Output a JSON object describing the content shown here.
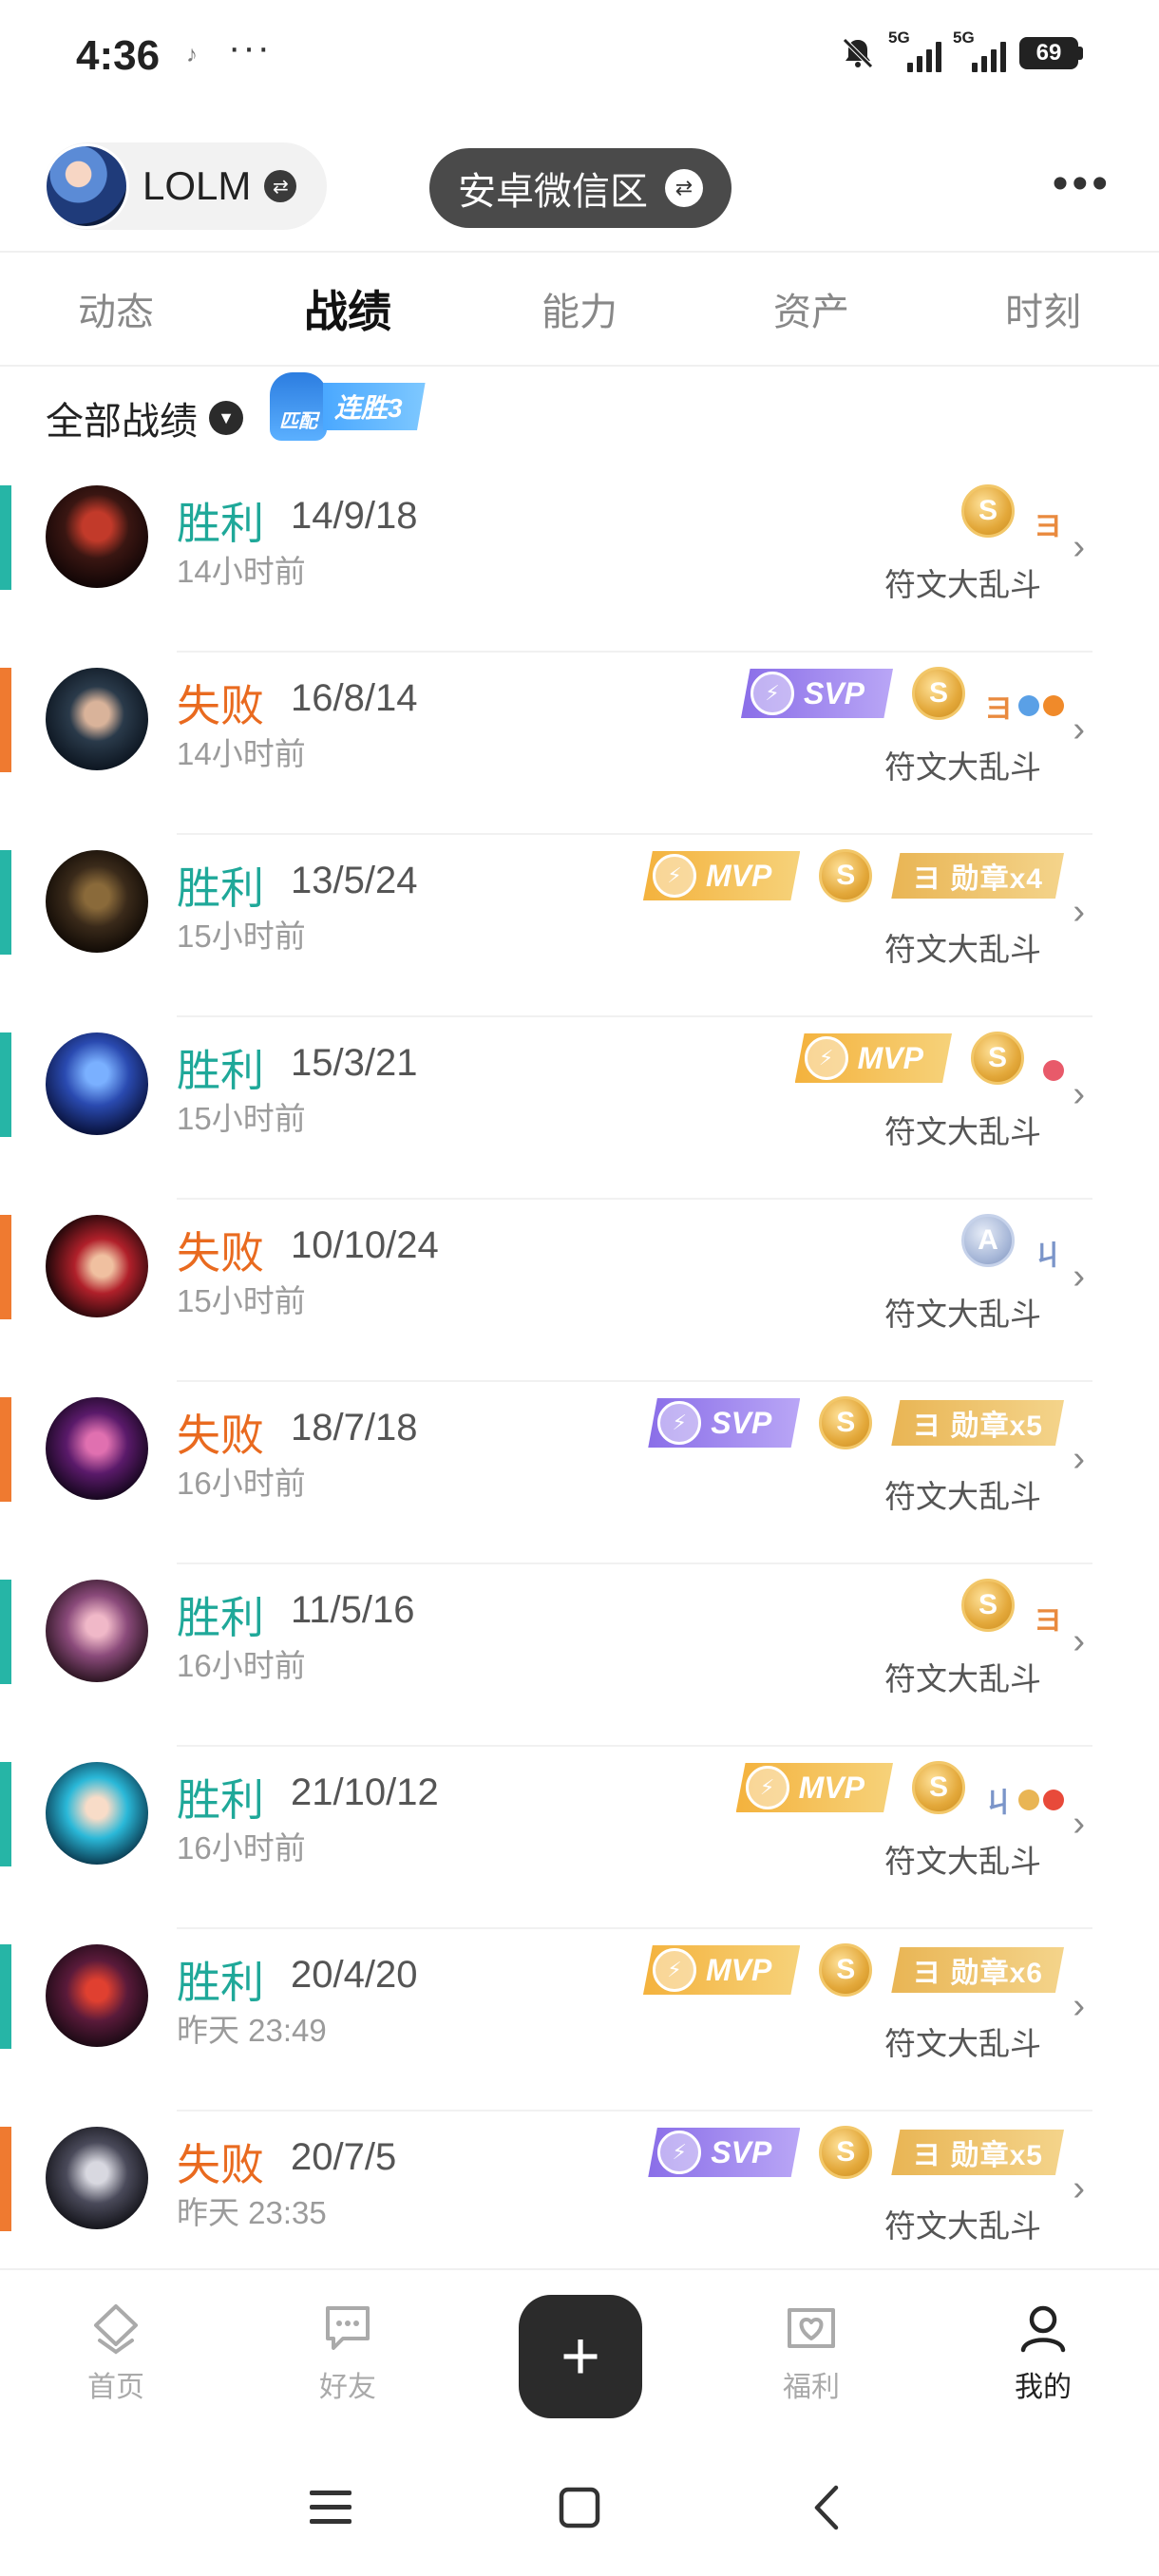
{
  "status_bar": {
    "time": "4:36",
    "dots": "···",
    "net1": "5G",
    "net2": "5G",
    "battery": "69"
  },
  "header": {
    "game_name": "LOLM",
    "region": "安卓微信区"
  },
  "tabs": [
    {
      "label": "动态",
      "active": false
    },
    {
      "label": "战绩",
      "active": true
    },
    {
      "label": "能力",
      "active": false
    },
    {
      "label": "资产",
      "active": false
    },
    {
      "label": "时刻",
      "active": false
    }
  ],
  "filter": {
    "label": "全部战绩",
    "streak_mode": "匹配",
    "streak_text": "连胜3"
  },
  "colors": {
    "win": "#26b5a6",
    "loss": "#ef7a30",
    "mvp": "#f4b23d",
    "svp": "#8a6ee8"
  },
  "matches": [
    {
      "result": "胜利",
      "outcome": "win",
      "kda": "14/9/18",
      "time": "14小时前",
      "mode": "符文大乱斗",
      "badges": [
        "S"
      ],
      "achv": "ヨ"
    },
    {
      "result": "失败",
      "outcome": "loss",
      "kda": "16/8/14",
      "time": "14小时前",
      "mode": "符文大乱斗",
      "badges": [
        "SVP",
        "S"
      ],
      "achv": "ヨ"
    },
    {
      "result": "胜利",
      "outcome": "win",
      "kda": "13/5/24",
      "time": "15小时前",
      "mode": "符文大乱斗",
      "badges": [
        "MVP",
        "S"
      ],
      "medal": "ヨ 勋章x4"
    },
    {
      "result": "胜利",
      "outcome": "win",
      "kda": "15/3/21",
      "time": "15小时前",
      "mode": "符文大乱斗",
      "badges": [
        "MVP",
        "S"
      ]
    },
    {
      "result": "失败",
      "outcome": "loss",
      "kda": "10/10/24",
      "time": "15小时前",
      "mode": "符文大乱斗",
      "badges": [
        "A"
      ],
      "achv": "ㄐ"
    },
    {
      "result": "失败",
      "outcome": "loss",
      "kda": "18/7/18",
      "time": "16小时前",
      "mode": "符文大乱斗",
      "badges": [
        "SVP",
        "S"
      ],
      "medal": "ヨ 勋章x5"
    },
    {
      "result": "胜利",
      "outcome": "win",
      "kda": "11/5/16",
      "time": "16小时前",
      "mode": "符文大乱斗",
      "badges": [
        "S"
      ],
      "achv": "ヨ"
    },
    {
      "result": "胜利",
      "outcome": "win",
      "kda": "21/10/12",
      "time": "16小时前",
      "mode": "符文大乱斗",
      "badges": [
        "MVP",
        "S"
      ],
      "achv": "ㄐ"
    },
    {
      "result": "胜利",
      "outcome": "win",
      "kda": "20/4/20",
      "time": "昨天 23:49",
      "mode": "符文大乱斗",
      "badges": [
        "MVP",
        "S"
      ],
      "medal": "ヨ 勋章x6"
    },
    {
      "result": "失败",
      "outcome": "loss",
      "kda": "20/7/5",
      "time": "昨天 23:35",
      "mode": "符文大乱斗",
      "badges": [
        "SVP",
        "S"
      ],
      "medal": "ヨ 勋章x5"
    }
  ],
  "bottom_nav": [
    {
      "label": "首页",
      "icon": "home-icon"
    },
    {
      "label": "好友",
      "icon": "chat-icon"
    },
    {
      "label": "福利",
      "icon": "gift-icon"
    },
    {
      "label": "我的",
      "icon": "profile-icon"
    }
  ],
  "fab": "+"
}
